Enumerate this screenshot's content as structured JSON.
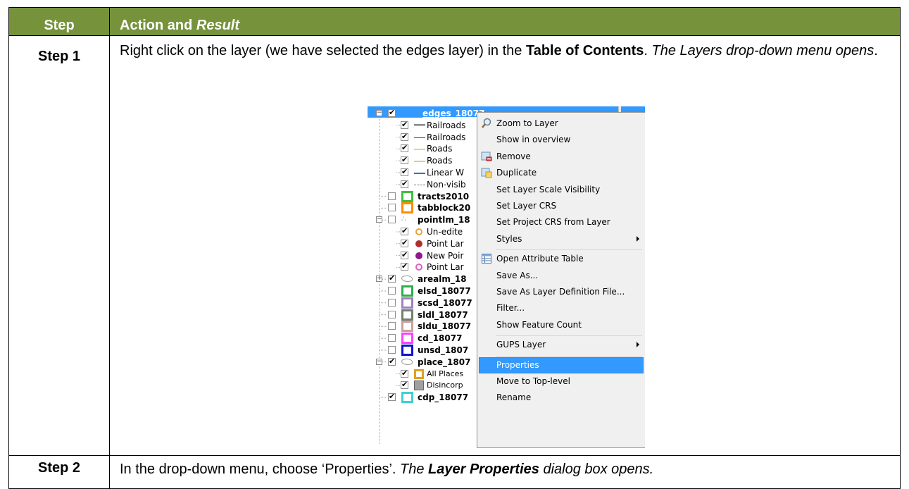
{
  "table": {
    "header": {
      "step": "Step",
      "action_prefix": "Action and ",
      "action_result": "Result"
    },
    "rows": [
      {
        "step": "Step 1",
        "text_a": "Right click on the layer (we have selected the edges layer) in the ",
        "text_b": "Table of Contents",
        "text_c": ". ",
        "text_d": "The Layers drop-down menu opens",
        "text_e": "."
      },
      {
        "step": "Step 2",
        "text_a": "In the drop-down menu, choose ‘Properties’. ",
        "text_b": "The ",
        "text_c": "Layer Properties",
        "text_d": " dialog box opens."
      }
    ]
  },
  "screenshot": {
    "layers": [
      {
        "name": "edges_18077",
        "checked": true,
        "level": 0,
        "expand": "-",
        "symbol": "none",
        "bold": true,
        "selected": true
      },
      {
        "name": "Railroads",
        "checked": true,
        "level": 1,
        "symbol": "rail-line-icon"
      },
      {
        "name": "Railroads",
        "checked": true,
        "level": 1,
        "symbol": "rail2-line-icon"
      },
      {
        "name": "Roads",
        "checked": true,
        "level": 1,
        "symbol": "road-line-icon",
        "color": "#e8d37a"
      },
      {
        "name": "Roads",
        "checked": true,
        "level": 1,
        "symbol": "road-line-icon",
        "color": "#d9cf9e"
      },
      {
        "name": "Linear W",
        "checked": true,
        "level": 1,
        "symbol": "water-line-icon",
        "color": "#2f6fd6"
      },
      {
        "name": "Non-visib",
        "checked": true,
        "level": 1,
        "symbol": "dash-line-icon"
      },
      {
        "name": "tracts2010",
        "checked": false,
        "level": 0,
        "symbol": "box",
        "color": "#3fbf3f",
        "bold": true
      },
      {
        "name": "tabblock20",
        "checked": false,
        "level": 0,
        "symbol": "box",
        "color": "#ff8c00",
        "bold": true
      },
      {
        "name": "pointlm_18",
        "checked": false,
        "level": 0,
        "expand": "-",
        "symbol": "points-icon",
        "bold": true
      },
      {
        "name": "Un-edite",
        "checked": true,
        "level": 1,
        "symbol": "dot",
        "color": "#e8a33a"
      },
      {
        "name": "Point Lar",
        "checked": true,
        "level": 1,
        "symbol": "star-dot",
        "color": "#b03030"
      },
      {
        "name": "New Poir",
        "checked": true,
        "level": 1,
        "symbol": "dot-filled",
        "color": "#8b1a8b"
      },
      {
        "name": "Point Lar",
        "checked": true,
        "level": 1,
        "symbol": "dot",
        "color": "#e060c0"
      },
      {
        "name": "arealm_18",
        "checked": true,
        "level": 0,
        "expand": "+",
        "symbol": "area-icon",
        "bold": true
      },
      {
        "name": "elsd_18077",
        "checked": false,
        "level": 0,
        "symbol": "box",
        "color": "#2fae4a",
        "bold": true
      },
      {
        "name": "scsd_18077",
        "checked": false,
        "level": 0,
        "symbol": "box",
        "color": "#a080c0",
        "bold": true
      },
      {
        "name": "sldl_18077",
        "checked": false,
        "level": 0,
        "symbol": "box",
        "color": "#708070",
        "bold": true
      },
      {
        "name": "sldu_18077",
        "checked": false,
        "level": 0,
        "symbol": "box",
        "color": "#c8a0a0",
        "bold": true
      },
      {
        "name": "cd_18077",
        "checked": false,
        "level": 0,
        "symbol": "box",
        "color": "#ff40ff",
        "bold": true
      },
      {
        "name": "unsd_1807",
        "checked": false,
        "level": 0,
        "symbol": "box",
        "color": "#1010d0",
        "bold": true
      },
      {
        "name": "place_1807",
        "checked": true,
        "level": 0,
        "expand": "-",
        "symbol": "area-icon",
        "bold": true
      },
      {
        "name": "All Places",
        "checked": true,
        "level": 1,
        "symbol": "box",
        "color": "#e0a020",
        "small": true
      },
      {
        "name": "Disincorp",
        "checked": true,
        "level": 1,
        "symbol": "fill",
        "color": "#a0a0a0",
        "small": true
      },
      {
        "name": "cdp_18077",
        "checked": true,
        "level": 0,
        "symbol": "box",
        "color": "#40d0d0",
        "bold": true
      }
    ],
    "menu": [
      {
        "label": "Zoom to Layer",
        "icon": "magnifier-icon"
      },
      {
        "label": "Show in overview"
      },
      {
        "label": "Remove",
        "icon": "remove-layer-icon"
      },
      {
        "label": "Duplicate",
        "icon": "duplicate-layer-icon"
      },
      {
        "label": "Set Layer Scale Visibility"
      },
      {
        "label": "Set Layer CRS"
      },
      {
        "label": "Set Project CRS from Layer"
      },
      {
        "label": "Styles",
        "submenu": true
      },
      {
        "sep": true
      },
      {
        "label": "Open Attribute Table",
        "icon": "table-icon"
      },
      {
        "label": "Save As..."
      },
      {
        "label": "Save As Layer Definition File..."
      },
      {
        "label": "Filter..."
      },
      {
        "label": "Show Feature Count"
      },
      {
        "sep": true
      },
      {
        "label": "GUPS Layer",
        "submenu": true
      },
      {
        "sep": true
      },
      {
        "label": "Properties",
        "highlighted": true
      },
      {
        "label": "Move to Top-level"
      },
      {
        "label": "Rename"
      }
    ],
    "colors": {
      "header_green": "#76933c",
      "selection_blue": "#3399ff"
    }
  }
}
